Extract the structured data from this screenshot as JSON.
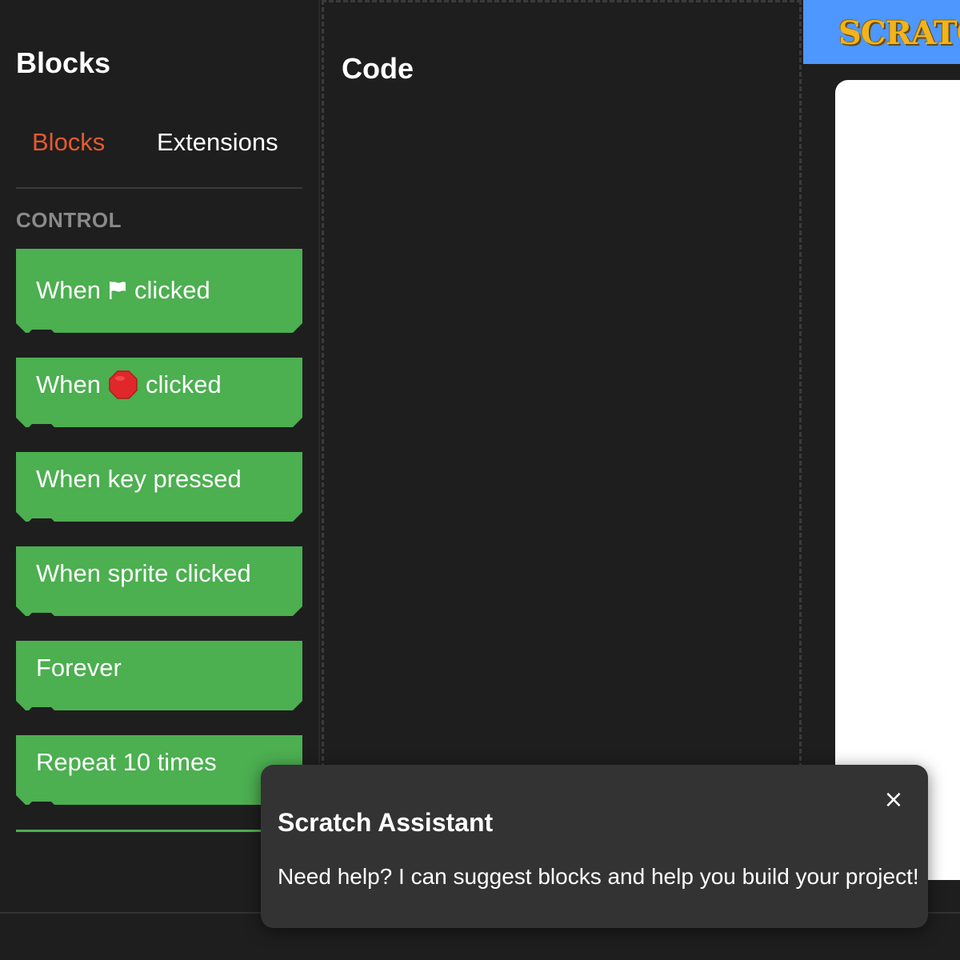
{
  "blocks_panel": {
    "title": "Blocks",
    "tabs": [
      {
        "label": "Blocks",
        "active": true
      },
      {
        "label": "Extensions",
        "active": false
      }
    ],
    "category": "CONTROL",
    "blocks": [
      {
        "pre": "When",
        "icon": "flag-icon",
        "post": "clicked"
      },
      {
        "pre": "When",
        "icon": "stop-icon",
        "post": "clicked"
      },
      {
        "label": "When key pressed"
      },
      {
        "label": "When sprite clicked"
      },
      {
        "label": "Forever"
      },
      {
        "label": "Repeat 10 times"
      }
    ],
    "block_color": "#4caf50",
    "active_tab_color": "#e45a2f"
  },
  "code_area": {
    "title": "Code"
  },
  "stage": {
    "logo_text": "SCRATCH",
    "header_color": "#4d97ff"
  },
  "assistant": {
    "title": "Scratch Assistant",
    "message": "Need help? I can suggest blocks and help you build your project!",
    "close_label": "×"
  }
}
